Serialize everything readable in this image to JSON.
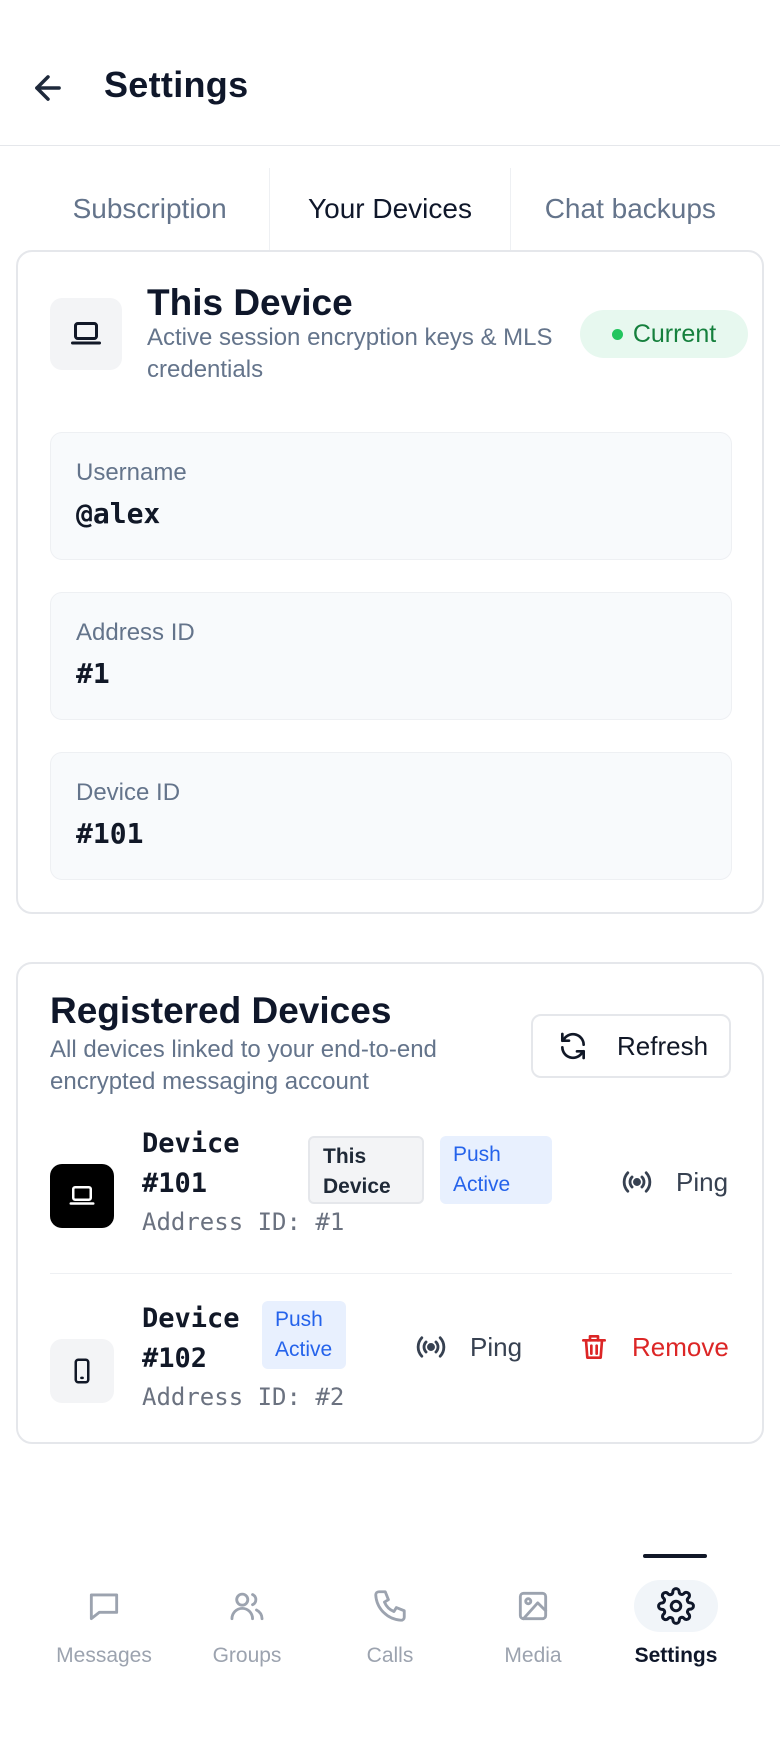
{
  "header": {
    "title": "Settings",
    "back_icon": "arrow-left-icon"
  },
  "tabs": [
    {
      "label": "Subscription",
      "active": false
    },
    {
      "label": "Your Devices",
      "active": true
    },
    {
      "label": "Chat backups",
      "active": false
    }
  ],
  "this_device": {
    "title": "This Device",
    "subtitle": "Active session encryption keys & MLS credentials",
    "status": "Current",
    "status_color": "#15803d",
    "icon": "laptop-icon",
    "fields": [
      {
        "label": "Username",
        "value": "@alex"
      },
      {
        "label": "Address ID",
        "value": "#1"
      },
      {
        "label": "Device ID",
        "value": "#101"
      }
    ]
  },
  "registered": {
    "title": "Registered Devices",
    "subtitle": "All devices linked to your end-to-end encrypted messaging account",
    "refresh_label": "Refresh",
    "devices": [
      {
        "name": "Device #101",
        "address": "Address ID: #1",
        "badge_this": "This Device",
        "badge_push": "Push Active",
        "ping_label": "Ping",
        "icon": "laptop-icon"
      },
      {
        "name": "Device #102",
        "address": "Address ID: #2",
        "badge_push": "Push Active",
        "ping_label": "Ping",
        "remove_label": "Remove",
        "icon": "phone-icon"
      }
    ]
  },
  "nav": [
    {
      "label": "Messages",
      "icon": "message-icon"
    },
    {
      "label": "Groups",
      "icon": "users-icon"
    },
    {
      "label": "Calls",
      "icon": "phone-call-icon"
    },
    {
      "label": "Media",
      "icon": "image-icon"
    },
    {
      "label": "Settings",
      "icon": "gear-icon",
      "active": true
    }
  ],
  "colors": {
    "accent_green": "#22c55e",
    "danger": "#dc2626",
    "push_blue": "#2563eb"
  }
}
